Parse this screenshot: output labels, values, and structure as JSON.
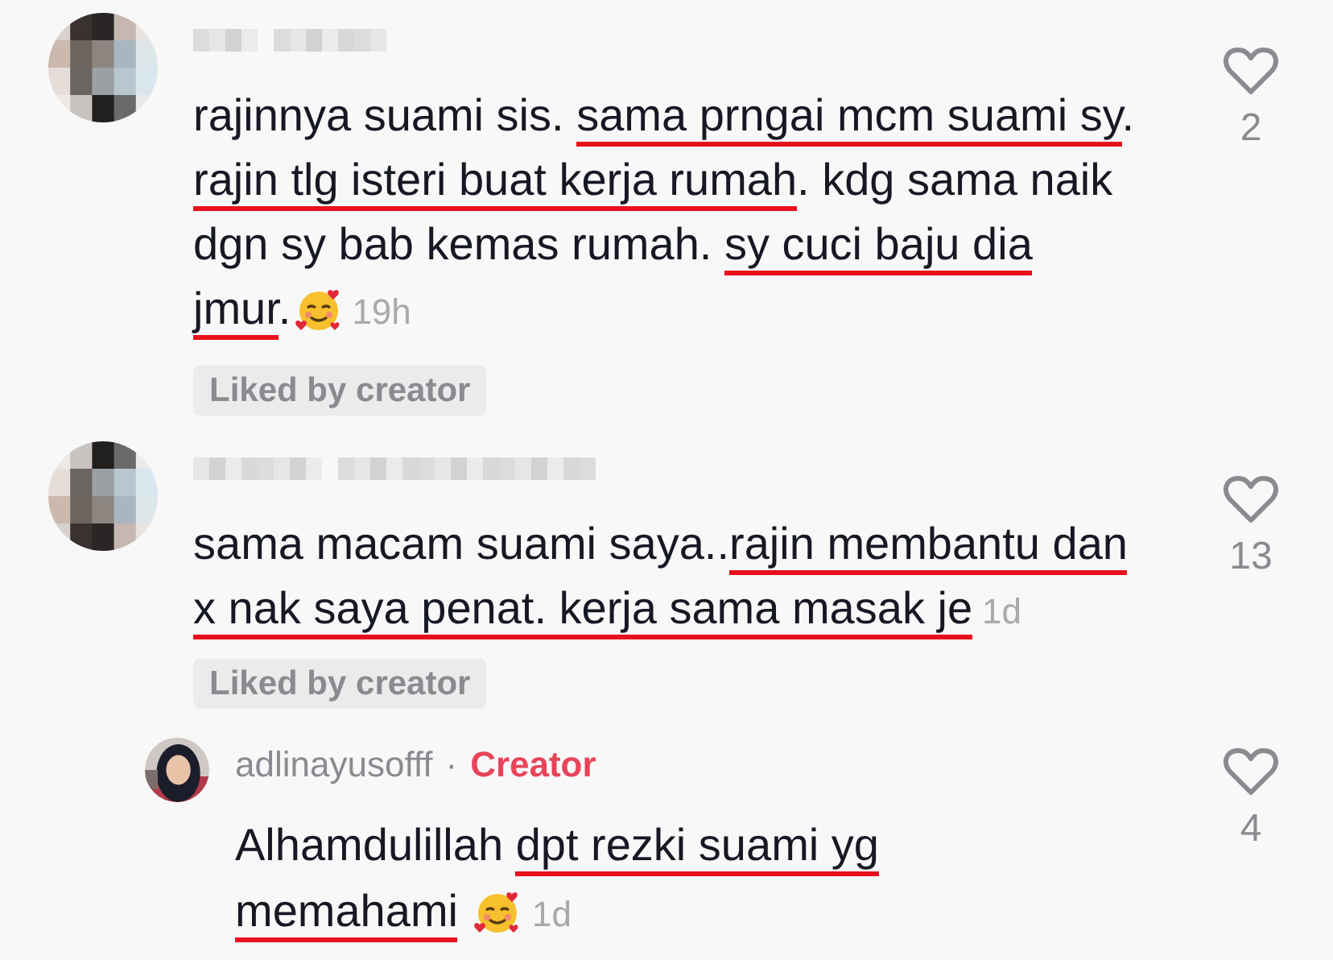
{
  "comments": [
    {
      "kind": "comment",
      "username_hidden": true,
      "lines": [
        [
          {
            "text": "rajinnya suami sis. ",
            "underlined": false
          },
          {
            "text": "sama prngai mcm suami sy",
            "underlined": true
          },
          {
            "text": ".",
            "underlined": false
          }
        ],
        [
          {
            "text": "rajin tlg isteri buat kerja rumah",
            "underlined": true
          },
          {
            "text": ". kdg sama naik",
            "underlined": false
          }
        ],
        [
          {
            "text": "dgn sy bab kemas rumah. ",
            "underlined": false
          },
          {
            "text": "sy cuci baju dia",
            "underlined": true
          }
        ],
        [
          {
            "text": "jmur",
            "underlined": true
          },
          {
            "text": ".",
            "underlined": false
          }
        ]
      ],
      "emoji": true,
      "time": "19h",
      "liked_by_creator": "Liked by creator",
      "liked": false,
      "likes": "2"
    },
    {
      "kind": "comment",
      "username_hidden": true,
      "lines": [
        [
          {
            "text": "sama macam suami saya..",
            "underlined": false
          },
          {
            "text": "rajin membantu dan",
            "underlined": true
          }
        ],
        [
          {
            "text": "x nak saya penat. kerja sama masak je",
            "underlined": true
          }
        ]
      ],
      "emoji": false,
      "time": "1d",
      "liked_by_creator": "Liked by creator",
      "liked": false,
      "likes": "13"
    },
    {
      "kind": "reply",
      "username_hidden": false,
      "username": "adlinayusofff",
      "separator": "·",
      "badge": "Creator",
      "lines": [
        [
          {
            "text": "Alhamdulillah ",
            "underlined": false
          },
          {
            "text": "dpt rezki suami yg",
            "underlined": true
          }
        ],
        [
          {
            "text": "memahami",
            "underlined": true
          }
        ]
      ],
      "emoji": true,
      "time": "1d",
      "liked": false,
      "likes": "4"
    }
  ]
}
